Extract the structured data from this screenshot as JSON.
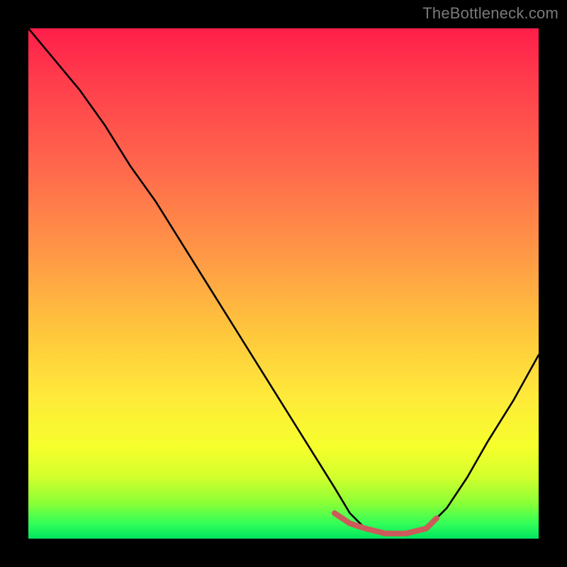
{
  "watermark": "TheBottleneck.com",
  "chart_data": {
    "type": "line",
    "title": "",
    "xlabel": "",
    "ylabel": "",
    "xlim": [
      0,
      100
    ],
    "ylim": [
      0,
      100
    ],
    "series": [
      {
        "name": "bottleneck-curve",
        "color": "#000000",
        "x": [
          0,
          5,
          10,
          15,
          20,
          25,
          30,
          35,
          40,
          45,
          50,
          55,
          60,
          63,
          66,
          70,
          74,
          78,
          82,
          86,
          90,
          95,
          100
        ],
        "values": [
          100,
          94,
          88,
          81,
          73,
          66,
          58,
          50,
          42,
          34,
          26,
          18,
          10,
          5,
          2,
          1,
          1,
          2,
          6,
          12,
          19,
          27,
          36
        ]
      }
    ],
    "highlight": {
      "name": "optimal-range",
      "color": "#cc5a5a",
      "x": [
        60,
        63,
        66,
        70,
        74,
        78,
        80
      ],
      "values": [
        5,
        3,
        2,
        1,
        1,
        2,
        4
      ]
    }
  }
}
